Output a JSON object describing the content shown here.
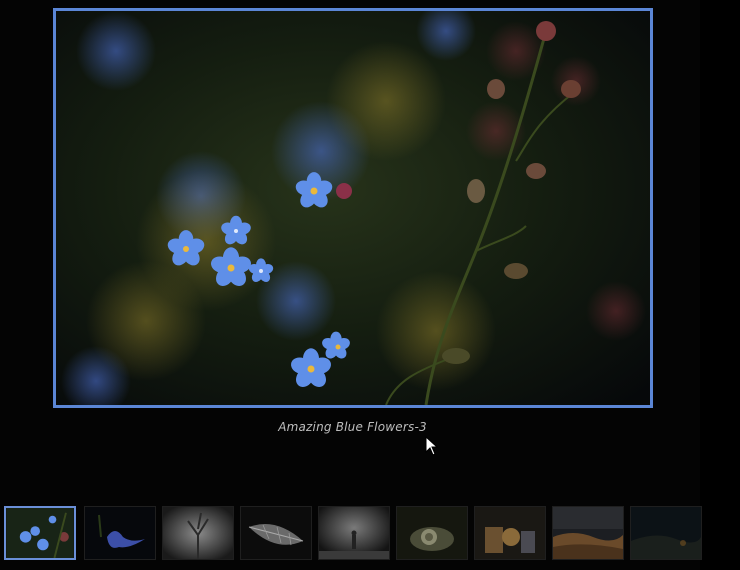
{
  "gallery": {
    "caption": "Amazing Blue Flowers-3",
    "accent_color": "#5b86d6",
    "main_image": "blue-forget-me-not-flowers-photo",
    "thumbnails": [
      {
        "image": "blue-flowers",
        "active": true
      },
      {
        "image": "blue-iris-flower",
        "active": false
      },
      {
        "image": "misty-tree",
        "active": false
      },
      {
        "image": "leaf-macro",
        "active": false
      },
      {
        "image": "figure-in-fog",
        "active": false
      },
      {
        "image": "snail-shell",
        "active": false
      },
      {
        "image": "still-life-objects",
        "active": false
      },
      {
        "image": "desert-landscape",
        "active": false
      },
      {
        "image": "dark-hills",
        "active": false
      }
    ]
  }
}
